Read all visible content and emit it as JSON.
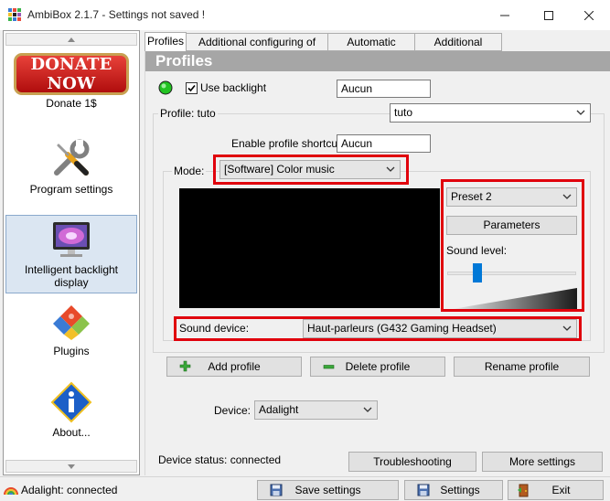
{
  "window": {
    "title": "AmbiBox 2.1.7  - Settings not saved !",
    "minimize": "–",
    "maximize": "☐",
    "close": "✕"
  },
  "sidebar": {
    "items": [
      {
        "label": "Donate 1$",
        "icon": "donate-now-banner",
        "banner_text": "DONATE NOW"
      },
      {
        "label": "Program settings",
        "icon": "tools-icon"
      },
      {
        "label": "Intelligent backlight display",
        "icon": "monitor-icon"
      },
      {
        "label": "Plugins",
        "icon": "puzzle-icon"
      },
      {
        "label": "About...",
        "icon": "info-icon"
      }
    ]
  },
  "tabs": [
    {
      "label": "Profiles",
      "active": true
    },
    {
      "label": "Additional configuring of zones"
    },
    {
      "label": "Automatic profiles"
    },
    {
      "label": "Additional settings"
    }
  ],
  "profiles": {
    "header": "Profiles",
    "use_backlight_label": "Use backlight",
    "use_backlight_checked": true,
    "backlight_value": "Aucun",
    "profile_label": "Profile: tuto",
    "profile_value": "tuto",
    "shortcut_label": "Enable profile shortcut:",
    "shortcut_value": "Aucun",
    "mode_label": "Mode:",
    "mode_value": "[Software] Color music",
    "preset_value": "Preset 2",
    "parameters_label": "Parameters",
    "sound_level_label": "Sound level:",
    "sound_level": 0.2,
    "sound_device_label": "Sound device:",
    "sound_device_value": "Haut-parleurs (G432 Gaming Headset)",
    "add_profile": "Add profile",
    "delete_profile": "Delete profile",
    "rename_profile": "Rename profile",
    "device_label": "Device:",
    "device_value": "Adalight",
    "device_status": "Device status: connected",
    "troubleshooting": "Troubleshooting",
    "more_settings": "More settings"
  },
  "statusbar": {
    "text": "Adalight: connected",
    "save": "Save settings",
    "settings": "Settings",
    "exit": "Exit"
  },
  "colors": {
    "highlight": "#e0000c",
    "header": "#a6a6a6",
    "led_on": "#22c322"
  }
}
